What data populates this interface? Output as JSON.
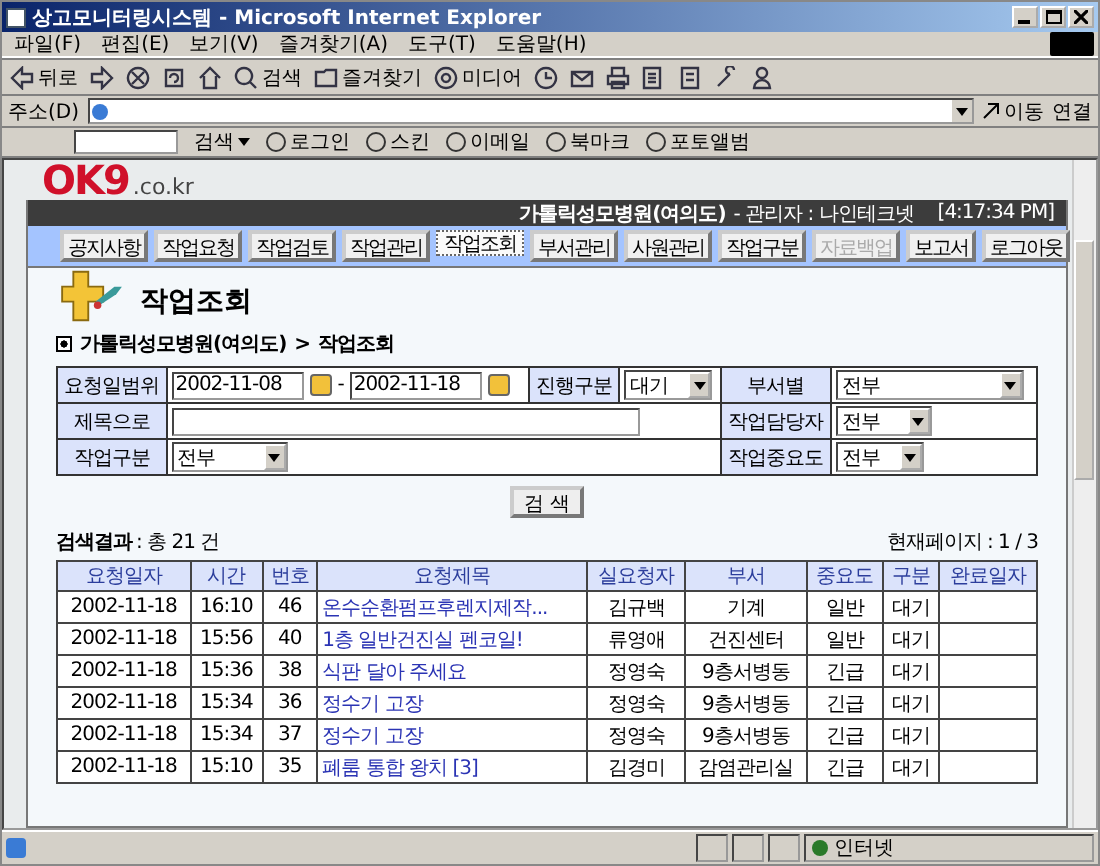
{
  "window": {
    "title": "상고모니터링시스템 - Microsoft Internet Explorer"
  },
  "menu": [
    "파일(F)",
    "편집(E)",
    "보기(V)",
    "즐겨찾기(A)",
    "도구(T)",
    "도움말(H)"
  ],
  "toolbar": [
    {
      "kind": "back",
      "label": "뒤로"
    },
    {
      "kind": "forward"
    },
    {
      "kind": "stop"
    },
    {
      "kind": "refresh"
    },
    {
      "kind": "home"
    },
    {
      "kind": "search",
      "label": "검색"
    },
    {
      "kind": "favorites",
      "label": "즐겨찾기"
    },
    {
      "kind": "media",
      "label": "미디어"
    },
    {
      "kind": "history"
    },
    {
      "kind": "mail"
    },
    {
      "kind": "print"
    },
    {
      "kind": "edit"
    },
    {
      "kind": "discuss"
    },
    {
      "kind": "tool"
    },
    {
      "kind": "messenger"
    }
  ],
  "address": {
    "label": "주소(D)",
    "go": "이동",
    "links": "연결"
  },
  "links_bar": {
    "search": "검색",
    "items": [
      "로그인",
      "스킨",
      "이메일",
      "북마크",
      "포토앨범"
    ]
  },
  "page": {
    "logo": {
      "main": "OK9",
      "domain": ".co.kr"
    },
    "header": {
      "org": "가톨릭성모병원(여의도)",
      "admin": "- 관리자 : 나인테크넷",
      "time": "[4:17:34 PM]"
    },
    "nav": [
      {
        "label": "공지사항",
        "selected": false,
        "disabled": false
      },
      {
        "label": "작업요청",
        "selected": false,
        "disabled": false
      },
      {
        "label": "작업검토",
        "selected": false,
        "disabled": false
      },
      {
        "label": "작업관리",
        "selected": false,
        "disabled": false
      },
      {
        "label": "작업조회",
        "selected": true,
        "disabled": false
      },
      {
        "label": "부서관리",
        "selected": false,
        "disabled": false
      },
      {
        "label": "사원관리",
        "selected": false,
        "disabled": false
      },
      {
        "label": "작업구분",
        "selected": false,
        "disabled": false
      },
      {
        "label": "자료백업",
        "selected": false,
        "disabled": true
      },
      {
        "label": "보고서",
        "selected": false,
        "disabled": false
      },
      {
        "label": "로그아웃",
        "selected": false,
        "disabled": false
      }
    ],
    "heading": "작업조회",
    "breadcrumb": {
      "org": "가톨릭성모병원(여의도)",
      "sep": ">",
      "page": "작업조회"
    },
    "form": {
      "date_label": "요청일범위",
      "date_from": "2002-11-08",
      "dash": "-",
      "date_to": "2002-11-18",
      "status_label": "진행구분",
      "status": "대기",
      "dept_label": "부서별",
      "dept": "전부",
      "title_label": "제목으로",
      "owner_label": "작업담당자",
      "owner": "전부",
      "type_label": "작업구분",
      "type": "전부",
      "priority_label": "작업중요도",
      "priority": "전부"
    },
    "search_button": "검 색",
    "result": {
      "label": "검색결과",
      "count": ": 총 21 건",
      "page": "현재페이지 : 1 / 3"
    },
    "table": {
      "columns": [
        "요청일자",
        "시간",
        "번호",
        "요청제목",
        "실요청자",
        "부서",
        "중요도",
        "구분",
        "완료일자"
      ],
      "rows": [
        [
          "2002-11-18",
          "16:10",
          "46",
          "온수순환펌프후렌지제작...",
          "김규백",
          "기계",
          "일반",
          "대기",
          ""
        ],
        [
          "2002-11-18",
          "15:56",
          "40",
          "1층 일반건진실 펜코일!",
          "류영애",
          "건진센터",
          "일반",
          "대기",
          ""
        ],
        [
          "2002-11-18",
          "15:36",
          "38",
          "식판 달아 주세요",
          "정영숙",
          "9층서병동",
          "긴급",
          "대기",
          ""
        ],
        [
          "2002-11-18",
          "15:34",
          "36",
          "정수기 고장",
          "정영숙",
          "9층서병동",
          "긴급",
          "대기",
          ""
        ],
        [
          "2002-11-18",
          "15:34",
          "37",
          "정수기 고장",
          "정영숙",
          "9층서병동",
          "긴급",
          "대기",
          ""
        ],
        [
          "2002-11-18",
          "15:10",
          "35",
          "폐룸 통합 왕치 [3]",
          "김경미",
          "감염관리실",
          "긴급",
          "대기",
          ""
        ]
      ]
    }
  },
  "status_bar": {
    "zone": "인터넷"
  }
}
